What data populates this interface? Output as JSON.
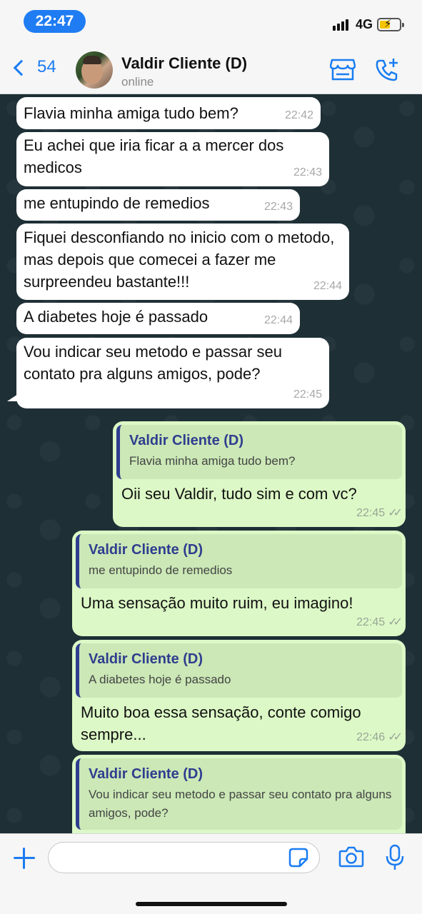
{
  "status_bar": {
    "time": "22:47",
    "network": "4G"
  },
  "header": {
    "back_count": "54",
    "contact_name": "Valdir Cliente (D)",
    "contact_status": "online",
    "icons": [
      "chevron-left-icon",
      "store-icon",
      "phone-add-icon"
    ]
  },
  "messages": [
    {
      "dir": "in",
      "text": "Flavia minha amiga tudo bem?",
      "time": "22:42"
    },
    {
      "dir": "in",
      "text": "Eu achei que iria ficar a a mercer dos medicos",
      "time": "22:43"
    },
    {
      "dir": "in",
      "text": "me entupindo de remedios",
      "time": "22:43"
    },
    {
      "dir": "in",
      "text": "Fiquei desconfiando no inicio com o metodo, mas depois que comecei a fazer me surpreendeu bastante!!!",
      "time": "22:44"
    },
    {
      "dir": "in",
      "text": "A diabetes hoje é passado",
      "time": "22:44"
    },
    {
      "dir": "in",
      "text": "Vou indicar seu metodo e passar seu contato pra alguns amigos, pode?",
      "time": "22:45"
    },
    {
      "dir": "out",
      "quote_name": "Valdir Cliente (D)",
      "quote_text": "Flavia minha amiga tudo bem?",
      "text": "Oii seu Valdir, tudo sim e com vc?",
      "time": "22:45"
    },
    {
      "dir": "out",
      "quote_name": "Valdir Cliente (D)",
      "quote_text": "me entupindo de remedios",
      "text": "Uma sensação muito ruim, eu imagino!",
      "time": "22:45"
    },
    {
      "dir": "out",
      "quote_name": "Valdir Cliente (D)",
      "quote_text": "A diabetes hoje é passado",
      "text": "Muito boa essa sensação, conte comigo sempre...",
      "time": "22:46"
    },
    {
      "dir": "out",
      "quote_name": "Valdir Cliente (D)",
      "quote_text": "Vou indicar seu metodo e passar seu contato pra alguns amigos, pode?",
      "text": "",
      "time": ""
    }
  ],
  "input_bar": {
    "placeholder": "",
    "icons": [
      "plus-icon",
      "sticker-icon",
      "camera-icon",
      "microphone-icon"
    ]
  },
  "colors": {
    "accent": "#1a7cf2",
    "chat_background": "#1e2f36",
    "incoming_bubble": "#ffffff",
    "outgoing_bubble": "#dcf8c6",
    "quote_bar": "#2f3d8f"
  }
}
